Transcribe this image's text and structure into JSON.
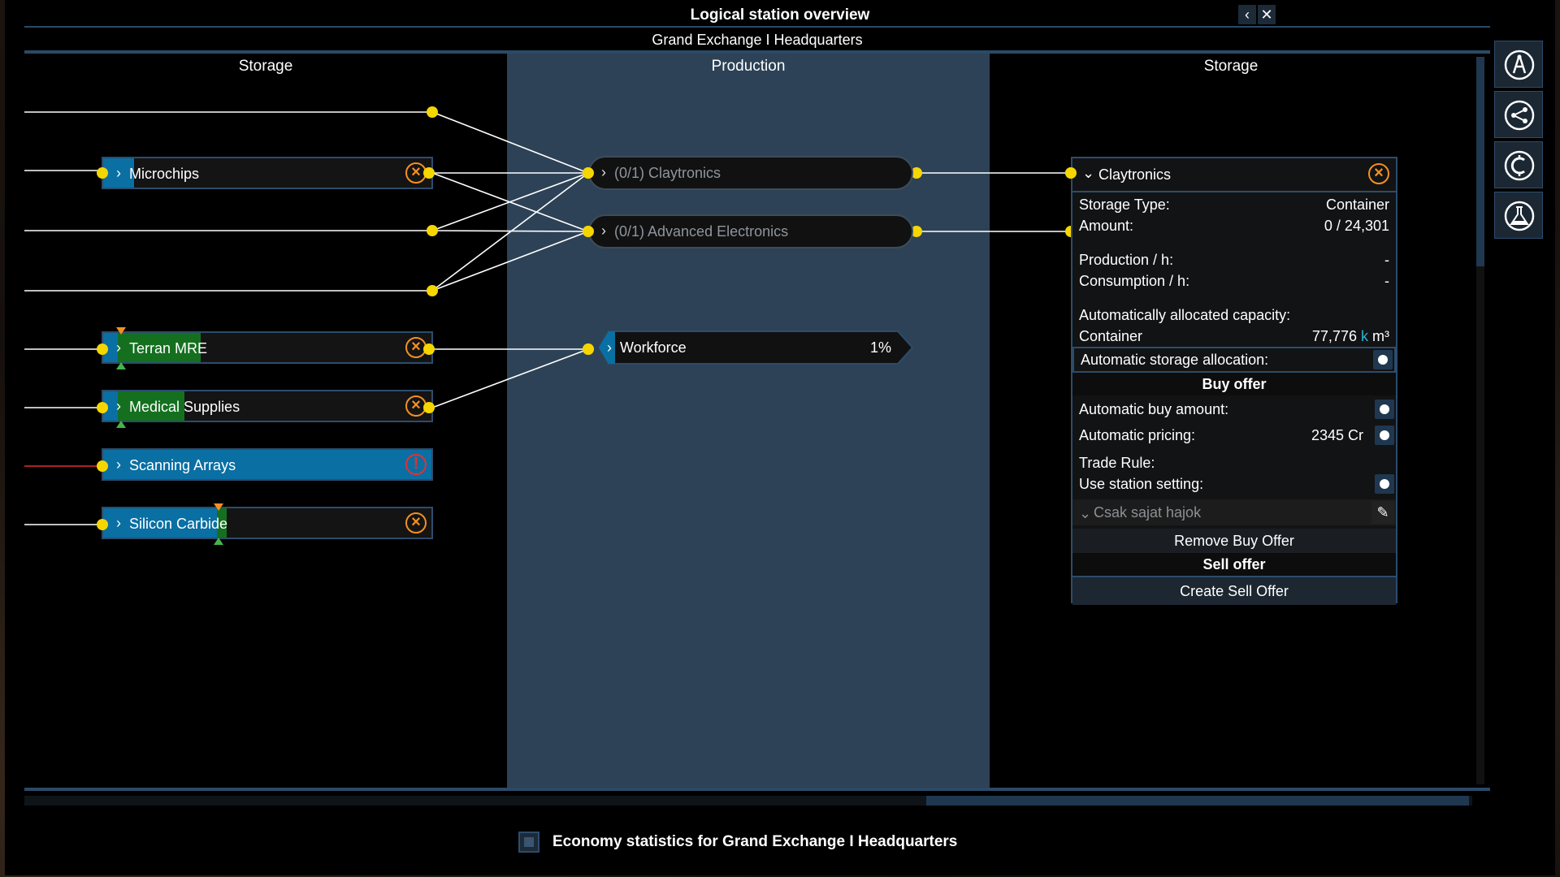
{
  "window": {
    "title": "Logical station overview",
    "subtitle": "Grand Exchange I Headquarters",
    "back_icon": "chevron-left-icon",
    "close_icon": "close-icon"
  },
  "columns": {
    "left": "Storage",
    "middle": "Production",
    "right": "Storage"
  },
  "storage_items": [
    {
      "label": "Microchips",
      "status": "warning",
      "fill": 0.1
    },
    {
      "label": "Terran MRE",
      "status": "warning",
      "fill": 0.28
    },
    {
      "label": "Medical Supplies",
      "status": "warning",
      "fill": 0.25
    },
    {
      "label": "Scanning Arrays",
      "status": "critical",
      "fill": 1.0
    },
    {
      "label": "Silicon Carbide",
      "status": "warning",
      "fill": 0.37
    }
  ],
  "production_items": [
    {
      "label": "(0/1) Claytronics"
    },
    {
      "label": "(0/1) Advanced Electronics"
    }
  ],
  "workforce": {
    "label": "Workforce",
    "percent": "1%"
  },
  "details": {
    "title": "Claytronics",
    "storage_type_label": "Storage Type:",
    "storage_type_value": "Container",
    "amount_label": "Amount:",
    "amount_value": "0 / 24,301",
    "production_label": "Production / h:",
    "production_value": "-",
    "consumption_label": "Consumption / h:",
    "consumption_value": "-",
    "auto_capacity_label": "Automatically allocated capacity:",
    "container_label": "Container",
    "container_value": "77,776",
    "container_unit_k": "k",
    "container_unit": "m³",
    "auto_storage_label": "Automatic storage allocation:",
    "buy_offer_heading": "Buy offer",
    "auto_buy_label": "Automatic buy amount:",
    "auto_pricing_label": "Automatic pricing:",
    "auto_pricing_value": "2345 Cr",
    "trade_rule_label": "Trade Rule:",
    "use_station_label": "Use station setting:",
    "trade_rule_value": "Csak sajat hajok",
    "remove_buy_label": "Remove Buy Offer",
    "sell_offer_heading": "Sell offer",
    "create_sell_label": "Create Sell Offer"
  },
  "toolbar": [
    "compass-icon",
    "share-icon",
    "credits-icon",
    "flask-icon"
  ],
  "footer": {
    "label": "Economy statistics for Grand Exchange I Headquarters"
  },
  "colors": {
    "accent": "#2c4c6c",
    "connector": "#f5d600",
    "warning": "#f39022",
    "critical": "#e03131",
    "fill_blue": "#0a6fa3",
    "fill_green": "#14701f"
  }
}
